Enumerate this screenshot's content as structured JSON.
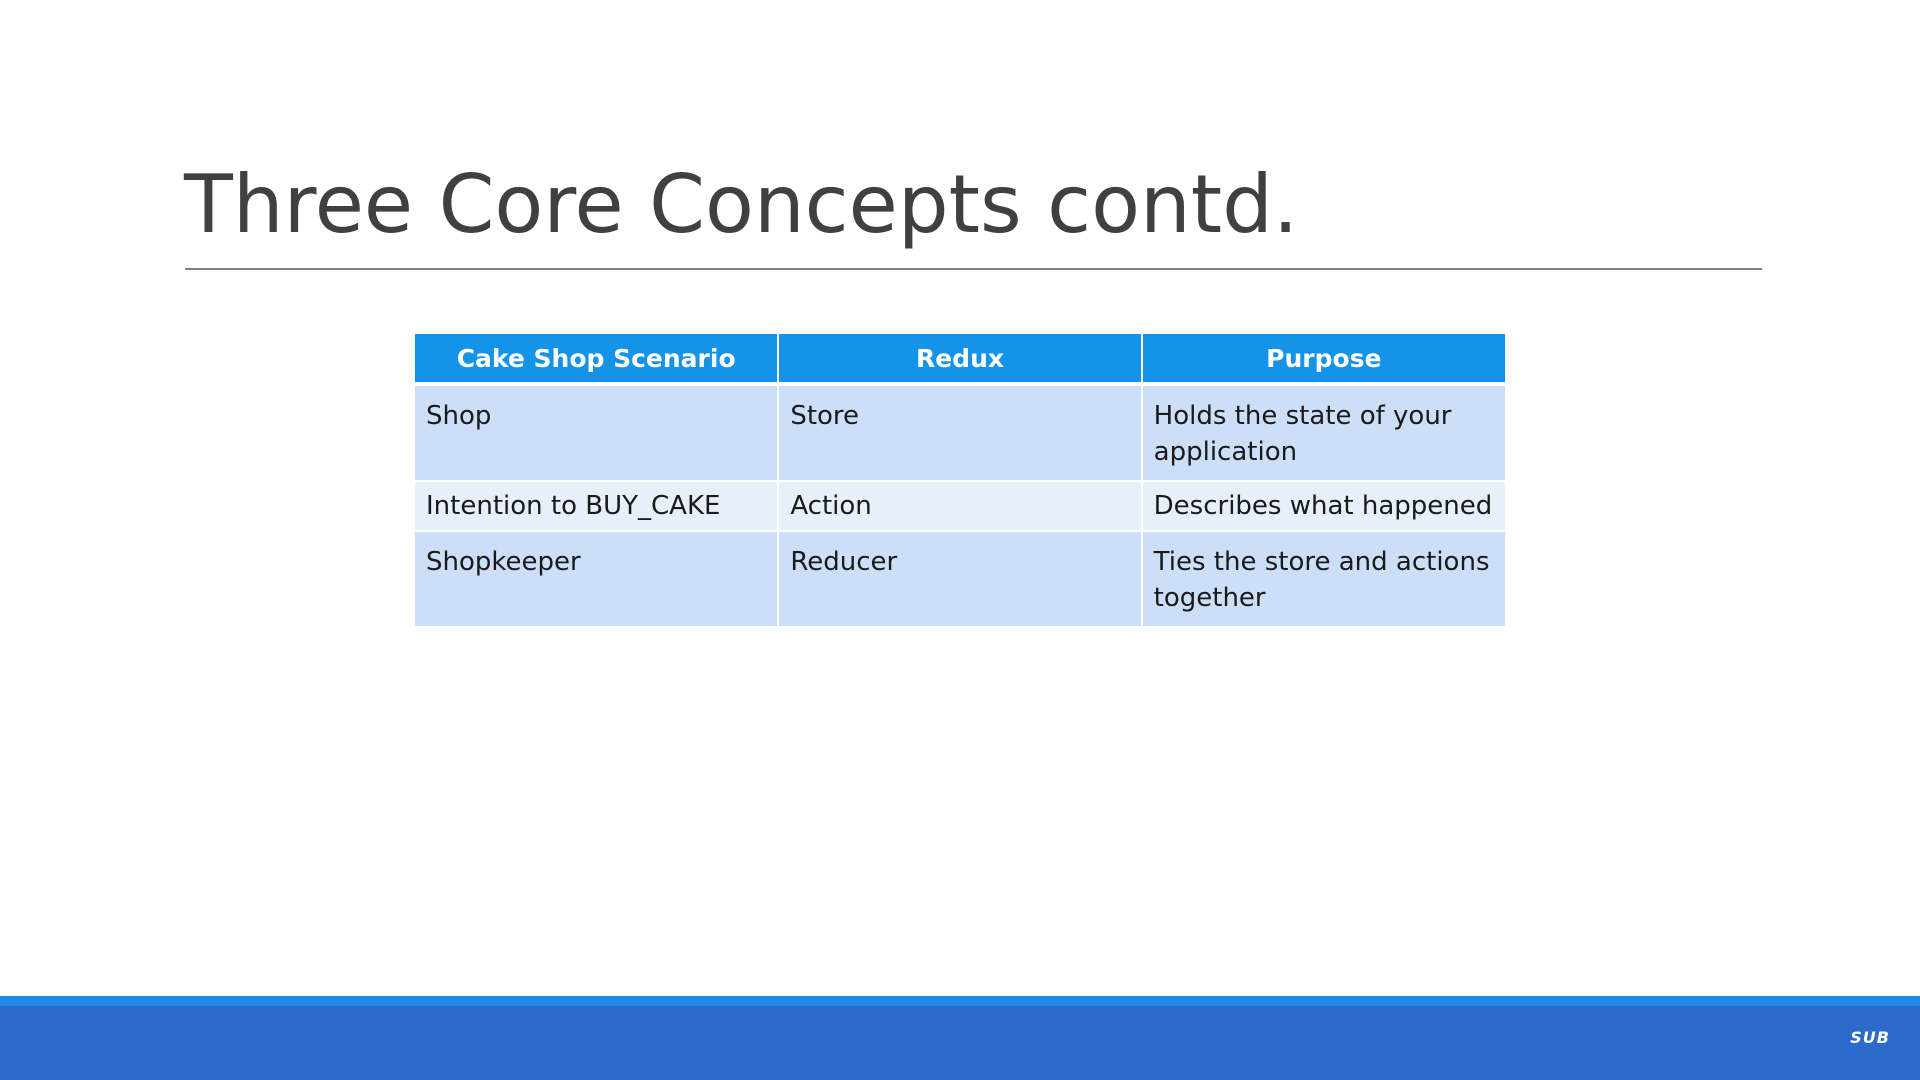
{
  "slide": {
    "title": "Three Core Concepts contd."
  },
  "table": {
    "headers": [
      "Cake Shop Scenario",
      "Redux",
      "Purpose"
    ],
    "rows": [
      [
        "Shop",
        "Store",
        "Holds the state of your application"
      ],
      [
        "Intention to BUY_CAKE",
        "Action",
        "Describes what happened"
      ],
      [
        "Shopkeeper",
        "Reducer",
        "Ties the store and actions together"
      ]
    ]
  },
  "footer": {
    "logo_text": "SUB"
  },
  "colors": {
    "header_bg": "#1593e8",
    "row_odd_bg": "#cddff8",
    "row_even_bg": "#e7effa",
    "footer_bar": "#2b6acb",
    "footer_accent": "#1e88e5"
  }
}
